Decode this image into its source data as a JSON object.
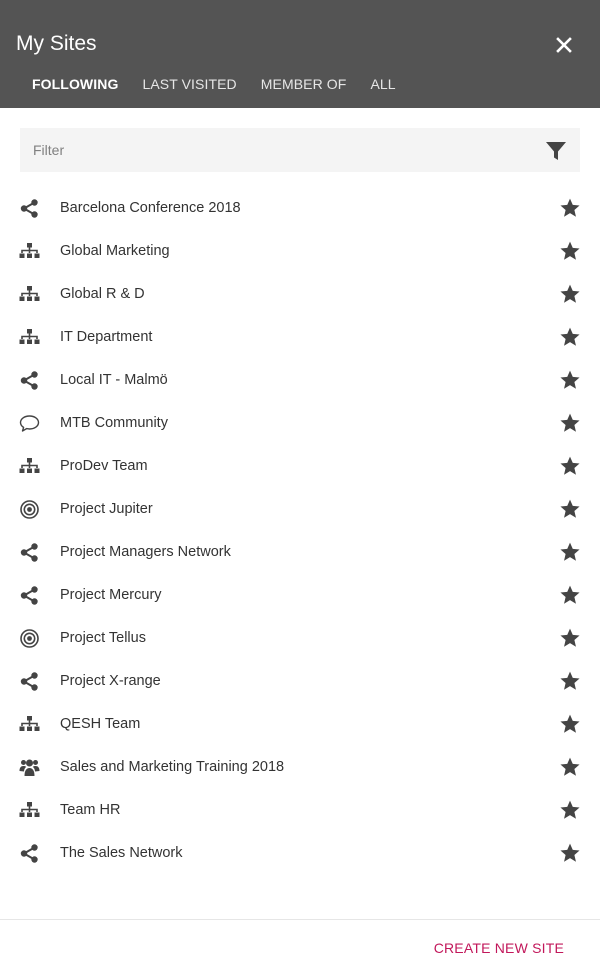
{
  "panel": {
    "title": "My Sites",
    "close_icon": "close-icon"
  },
  "tabs": [
    {
      "label": "FOLLOWING",
      "active": true
    },
    {
      "label": "LAST VISITED",
      "active": false
    },
    {
      "label": "MEMBER OF",
      "active": false
    },
    {
      "label": "ALL",
      "active": false
    }
  ],
  "filter": {
    "placeholder": "Filter",
    "value": "",
    "icon": "filter-icon"
  },
  "sites": [
    {
      "name": "Barcelona Conference 2018",
      "icon": "share-icon",
      "followed": true
    },
    {
      "name": "Global Marketing",
      "icon": "sitemap-icon",
      "followed": true
    },
    {
      "name": "Global R & D",
      "icon": "sitemap-icon",
      "followed": true
    },
    {
      "name": "IT Department",
      "icon": "sitemap-icon",
      "followed": true
    },
    {
      "name": "Local IT - Malmö",
      "icon": "share-icon",
      "followed": true
    },
    {
      "name": "MTB Community",
      "icon": "comment-icon",
      "followed": true
    },
    {
      "name": "ProDev Team",
      "icon": "sitemap-icon",
      "followed": true
    },
    {
      "name": "Project Jupiter",
      "icon": "target-icon",
      "followed": true
    },
    {
      "name": "Project Managers Network",
      "icon": "share-icon",
      "followed": true
    },
    {
      "name": "Project Mercury",
      "icon": "share-icon",
      "followed": true
    },
    {
      "name": "Project Tellus",
      "icon": "target-icon",
      "followed": true
    },
    {
      "name": "Project X-range",
      "icon": "share-icon",
      "followed": true
    },
    {
      "name": "QESH Team",
      "icon": "sitemap-icon",
      "followed": true
    },
    {
      "name": "Sales and Marketing Training 2018",
      "icon": "users-icon",
      "followed": true
    },
    {
      "name": "Team HR",
      "icon": "sitemap-icon",
      "followed": true
    },
    {
      "name": "The Sales Network",
      "icon": "share-icon",
      "followed": true
    }
  ],
  "footer": {
    "create_label": "CREATE NEW SITE"
  },
  "colors": {
    "header_bg": "#545454",
    "accent": "#c2185b",
    "icon": "#444444"
  }
}
